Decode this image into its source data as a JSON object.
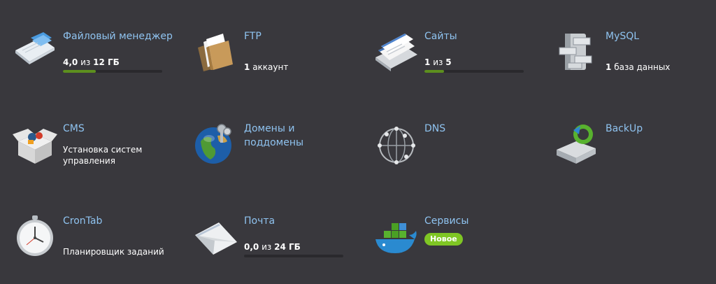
{
  "tiles": {
    "files": {
      "title": "Файловый менеджер",
      "used": "4,0",
      "sep": "из",
      "total": "12 ГБ",
      "progress": 0.33
    },
    "ftp": {
      "title": "FTP",
      "count": "1",
      "label": "аккаунт"
    },
    "sites": {
      "title": "Сайты",
      "used": "1",
      "sep": "из",
      "total": "5",
      "progress": 0.2
    },
    "mysql": {
      "title": "MySQL",
      "count": "1",
      "label": "база данных"
    },
    "cms": {
      "title": "CMS",
      "desc": "Установка систем управления"
    },
    "domains": {
      "title": "Домены и поддомены"
    },
    "dns": {
      "title": "DNS"
    },
    "backup": {
      "title": "BackUp"
    },
    "crontab": {
      "title": "CronTab",
      "desc": "Планировщик заданий"
    },
    "mail": {
      "title": "Почта",
      "used": "0,0",
      "sep": "из",
      "total": "24 ГБ",
      "progress": 0.0
    },
    "services": {
      "title": "Сервисы",
      "badge": "Новое"
    }
  },
  "icons": {
    "files": "file-manager-icon",
    "ftp": "ftp-folder-icon",
    "sites": "websites-icon",
    "mysql": "database-icon",
    "cms": "cms-box-icon",
    "domains": "globe-keys-icon",
    "dns": "dns-network-icon",
    "backup": "backup-drive-icon",
    "crontab": "clock-icon",
    "mail": "mail-envelope-icon",
    "services": "docker-whale-icon"
  },
  "colors": {
    "background": "#39383d",
    "link": "#8fc3f0",
    "progress": "#5d8f1e",
    "badge": "#7fc624"
  }
}
